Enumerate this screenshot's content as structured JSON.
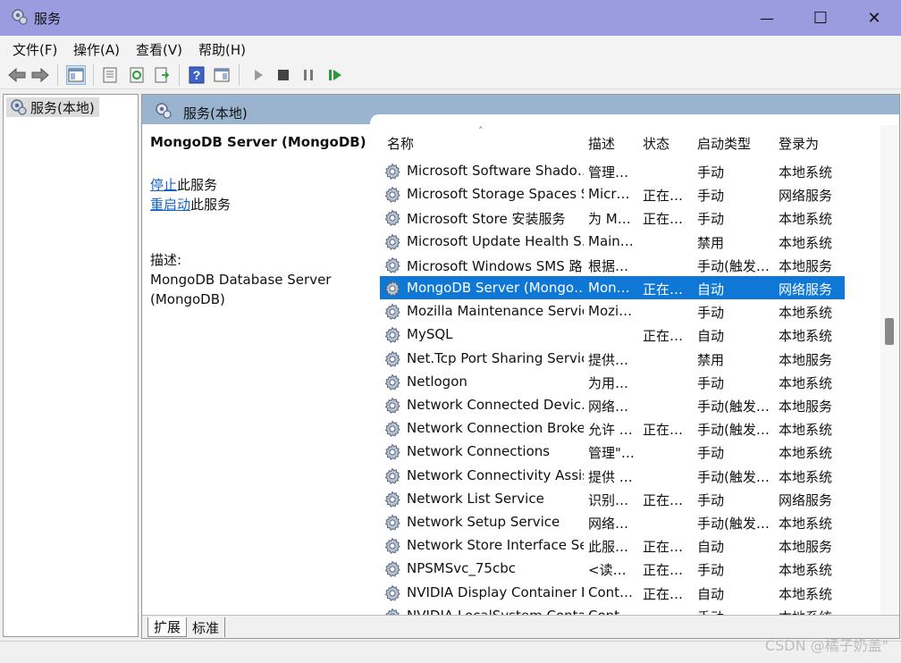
{
  "window": {
    "title": "服务",
    "minimize": "—",
    "maximize": "☐",
    "close": "✕"
  },
  "menu": [
    "文件(F)",
    "操作(A)",
    "查看(V)",
    "帮助(H)"
  ],
  "tree": {
    "root_label": "服务(本地)"
  },
  "panel": {
    "header": "服务(本地)",
    "service_title": "MongoDB Server (MongoDB)",
    "stop_link": "停止",
    "stop_suffix": "此服务",
    "restart_link": "重启动",
    "restart_suffix": "此服务",
    "desc_label": "描述:",
    "desc_line1": "MongoDB Database Server",
    "desc_line2": "(MongoDB)"
  },
  "table": {
    "columns": [
      "名称",
      "描述",
      "状态",
      "启动类型",
      "登录为"
    ],
    "rows": [
      [
        "Microsoft Software Shado…",
        "管理…",
        "",
        "手动",
        "本地系统"
      ],
      [
        "Microsoft Storage Spaces S…",
        "Micr…",
        "正在…",
        "手动",
        "网络服务"
      ],
      [
        "Microsoft Store 安装服务",
        "为 M…",
        "正在…",
        "手动",
        "本地系统"
      ],
      [
        "Microsoft Update Health S…",
        "Main…",
        "",
        "禁用",
        "本地系统"
      ],
      [
        "Microsoft Windows SMS 路…",
        "根据…",
        "",
        "手动(触发…",
        "本地服务"
      ],
      [
        "MongoDB Server (Mongo…",
        "Mon…",
        "正在…",
        "自动",
        "网络服务"
      ],
      [
        "Mozilla Maintenance Service",
        "Mozi…",
        "",
        "手动",
        "本地系统"
      ],
      [
        "MySQL",
        "",
        "正在…",
        "自动",
        "本地系统"
      ],
      [
        "Net.Tcp Port Sharing Service",
        "提供…",
        "",
        "禁用",
        "本地服务"
      ],
      [
        "Netlogon",
        "为用…",
        "",
        "手动",
        "本地系统"
      ],
      [
        "Network Connected Devic…",
        "网络…",
        "",
        "手动(触发…",
        "本地服务"
      ],
      [
        "Network Connection Broker",
        "允许 …",
        "正在…",
        "手动(触发…",
        "本地系统"
      ],
      [
        "Network Connections",
        "管理\"…",
        "",
        "手动",
        "本地系统"
      ],
      [
        "Network Connectivity Assis…",
        "提供 …",
        "",
        "手动(触发…",
        "本地系统"
      ],
      [
        "Network List Service",
        "识别…",
        "正在…",
        "手动",
        "网络服务"
      ],
      [
        "Network Setup Service",
        "网络…",
        "",
        "手动(触发…",
        "本地系统"
      ],
      [
        "Network Store Interface Se…",
        "此服…",
        "正在…",
        "自动",
        "本地服务"
      ],
      [
        "NPSMSvc_75cbc",
        "<读…",
        "正在…",
        "手动",
        "本地系统"
      ],
      [
        "NVIDIA Display Container LS",
        "Cont…",
        "正在…",
        "自动",
        "本地系统"
      ],
      [
        "NVIDIA LocalSystem Conta…",
        "Cont…",
        "",
        "手动",
        "本地系统"
      ]
    ],
    "selected_index": 5
  },
  "tabs": [
    "扩展",
    "标准"
  ],
  "watermark": "CSDN @橘子奶盖\""
}
